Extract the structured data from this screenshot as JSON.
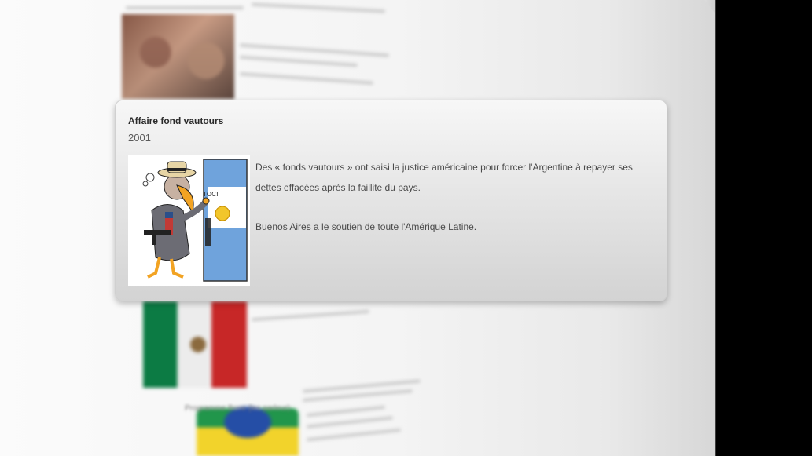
{
  "popover": {
    "title": "Affaire fond vautours",
    "year": "2001",
    "paragraphs": [
      "Des « fonds vautours » ont saisi la justice américaine pour forcer l'Argentine à repayer ses dettes effacées après la faillite du pays.",
      "Buenos Aires a le soutien de toute l'Amérique Latine."
    ],
    "image": {
      "icon": "cartoon-vulture-illustration",
      "door_text": "TOC!"
    }
  },
  "background": {
    "blurred_title": "Programme Bons (les parleur)"
  }
}
